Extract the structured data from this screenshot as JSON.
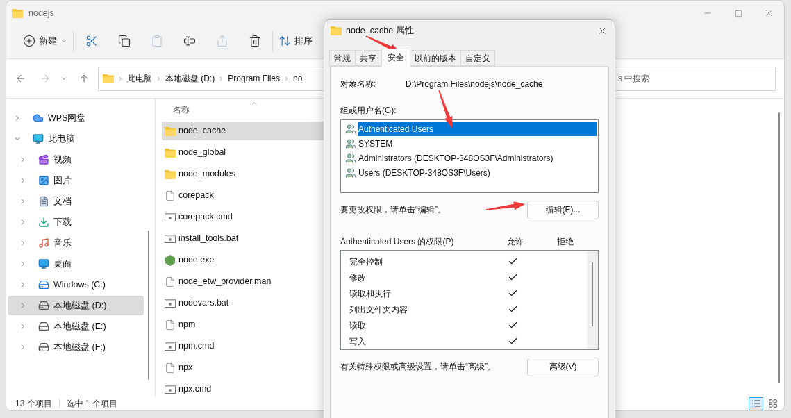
{
  "explorer": {
    "title": "nodejs",
    "toolbar": [
      {
        "kind": "new",
        "label": "新建",
        "disabled": false
      },
      {
        "kind": "cut",
        "disabled": false
      },
      {
        "kind": "copy",
        "disabled": false
      },
      {
        "kind": "paste",
        "disabled": true
      },
      {
        "kind": "rename",
        "disabled": false
      },
      {
        "kind": "share",
        "disabled": true
      },
      {
        "kind": "delete",
        "disabled": false
      },
      {
        "kind": "sort",
        "label": "排序",
        "disabled": false
      }
    ],
    "address": {
      "crumbs": [
        "此电脑",
        "本地磁盘 (D:)",
        "Program Files",
        "no"
      ]
    },
    "search": {
      "placeholder": "s 中搜索"
    },
    "nav": [
      {
        "label": "WPS网盘",
        "kind": "cloud",
        "expanded": false,
        "selected": false
      },
      {
        "label": "此电脑",
        "kind": "pc",
        "expanded": true,
        "selected": false,
        "children": [
          {
            "label": "视频",
            "kind": "video",
            "expanded": false,
            "selected": false
          },
          {
            "label": "图片",
            "kind": "pictures",
            "expanded": false,
            "selected": false
          },
          {
            "label": "文档",
            "kind": "documents",
            "expanded": false,
            "selected": false
          },
          {
            "label": "下载",
            "kind": "downloads",
            "expanded": false,
            "selected": false
          },
          {
            "label": "音乐",
            "kind": "music",
            "expanded": false,
            "selected": false
          },
          {
            "label": "桌面",
            "kind": "desktop",
            "expanded": false,
            "selected": false
          },
          {
            "label": "Windows (C:)",
            "kind": "system_drive",
            "expanded": false,
            "selected": false
          },
          {
            "label": "本地磁盘 (D:)",
            "kind": "drive",
            "expanded": false,
            "selected": true
          },
          {
            "label": "本地磁盘 (E:)",
            "kind": "drive",
            "expanded": false,
            "selected": false
          },
          {
            "label": "本地磁盘 (F:)",
            "kind": "drive",
            "expanded": false,
            "selected": false
          }
        ]
      }
    ],
    "column_header": "名称",
    "files": [
      {
        "name": "node_cache",
        "kind": "folder",
        "selected": true
      },
      {
        "name": "node_global",
        "kind": "folder",
        "selected": false
      },
      {
        "name": "node_modules",
        "kind": "folder",
        "selected": false
      },
      {
        "name": "corepack",
        "kind": "file",
        "selected": false
      },
      {
        "name": "corepack.cmd",
        "kind": "script",
        "selected": false
      },
      {
        "name": "install_tools.bat",
        "kind": "script",
        "selected": false
      },
      {
        "name": "node.exe",
        "kind": "exe",
        "selected": false
      },
      {
        "name": "node_etw_provider.man",
        "kind": "file",
        "selected": false
      },
      {
        "name": "nodevars.bat",
        "kind": "script",
        "selected": false
      },
      {
        "name": "npm",
        "kind": "file",
        "selected": false
      },
      {
        "name": "npm.cmd",
        "kind": "script",
        "selected": false
      },
      {
        "name": "npx",
        "kind": "file",
        "selected": false
      },
      {
        "name": "npx.cmd",
        "kind": "script",
        "selected": false
      }
    ],
    "status_bar": {
      "count": "13 个项目",
      "selection": "选中 1 个项目"
    },
    "views": [
      {
        "kind": "details",
        "selected": true
      },
      {
        "kind": "tiles",
        "selected": false
      }
    ]
  },
  "dialog": {
    "title": "node_cache 属性",
    "tabs": [
      {
        "label": "常规",
        "selected": false
      },
      {
        "label": "共享",
        "selected": false
      },
      {
        "label": "安全",
        "selected": true
      },
      {
        "label": "以前的版本",
        "selected": false
      },
      {
        "label": "自定义",
        "selected": false
      }
    ],
    "object_label": "对象名称:",
    "object_value": "D:\\Program Files\\nodejs\\node_cache",
    "group_label": "组或用户名(G):",
    "users": [
      {
        "name": "Authenticated Users",
        "selected": true
      },
      {
        "name": "SYSTEM",
        "selected": false
      },
      {
        "name": "Administrators (DESKTOP-348OS3F\\Administrators)",
        "selected": false
      },
      {
        "name": "Users (DESKTOP-348OS3F\\Users)",
        "selected": false
      }
    ],
    "edit_hint": "要更改权限，请单击“编辑”。",
    "edit_button": "编辑(E)...",
    "permissions_title": "Authenticated Users 的权限(P)",
    "allow_header": "允许",
    "deny_header": "拒绝",
    "permissions": [
      {
        "name": "完全控制",
        "allow": true,
        "deny": false
      },
      {
        "name": "修改",
        "allow": true,
        "deny": false
      },
      {
        "name": "读取和执行",
        "allow": true,
        "deny": false
      },
      {
        "name": "列出文件夹内容",
        "allow": true,
        "deny": false
      },
      {
        "name": "读取",
        "allow": true,
        "deny": false
      },
      {
        "name": "写入",
        "allow": true,
        "deny": false
      }
    ],
    "advanced_hint": "有关特殊权限或高级设置，请单击“高级”。",
    "advanced_button": "高级(V)"
  }
}
